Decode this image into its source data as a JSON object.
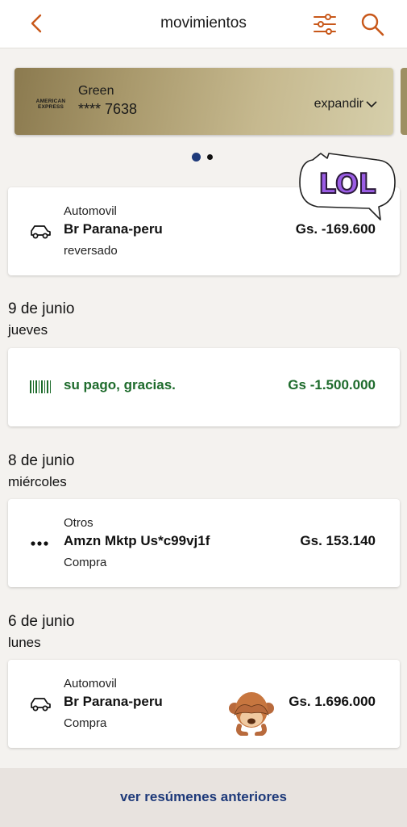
{
  "header": {
    "title": "movimientos",
    "back_icon": "chevron-left-icon",
    "filter_icon": "sliders-icon",
    "search_icon": "search-icon",
    "accent_color": "#c8581a"
  },
  "card": {
    "logo_text": "AMERICAN EXPRESS",
    "brand": "Green",
    "number": "**** 7638",
    "expand_label": "expandir",
    "pager_total": 2,
    "pager_active": 1
  },
  "transactions": [
    {
      "category": "Automovil",
      "merchant": "Br Parana-peru",
      "status": "reversado",
      "amount": "Gs. -169.600",
      "icon": "car-icon"
    },
    {
      "date": "9 de junio",
      "weekday": "jueves",
      "merchant": "su pago, gracias.",
      "amount": "Gs -1.500.000",
      "icon": "barcode-icon",
      "color": "#1e6b2c"
    },
    {
      "date": "8 de junio",
      "weekday": "miércoles",
      "category": "Otros",
      "merchant": "Amzn Mktp Us*c99vj1f",
      "status": "Compra",
      "amount": "Gs. 153.140",
      "icon": "more-dots-icon"
    },
    {
      "date": "6 de junio",
      "weekday": "lunes",
      "category": "Automovil",
      "merchant": "Br Parana-peru",
      "status": "Compra",
      "amount": "Gs. 1.696.000",
      "icon": "car-icon"
    }
  ],
  "stickers": {
    "lol_text": "LOL",
    "monkey": "see-no-evil-monkey-icon"
  },
  "footer": {
    "link_label": "ver resúmenes anteriores",
    "link_color": "#1e3a7a"
  }
}
